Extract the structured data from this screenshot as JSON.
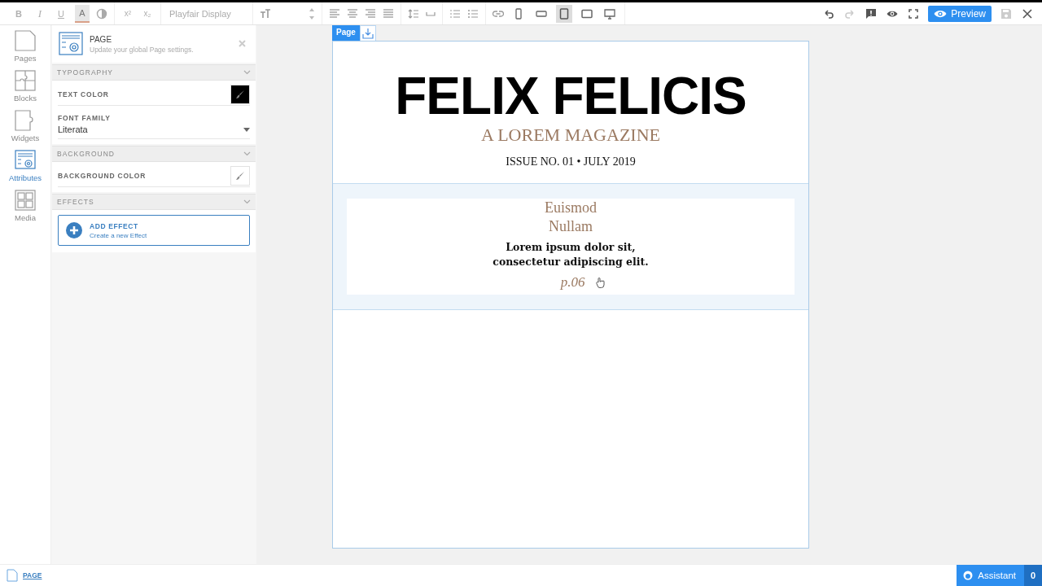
{
  "toolbar": {
    "format": [
      {
        "glyph": "B",
        "kind": "bold",
        "selected": false
      },
      {
        "glyph": "I",
        "kind": "italic",
        "selected": false
      },
      {
        "glyph": "U",
        "kind": "underline",
        "selected": false
      },
      {
        "glyph": "A",
        "kind": "color",
        "selected": true
      }
    ],
    "scripts": [
      {
        "glyph": "x²"
      },
      {
        "glyph": "x₂"
      }
    ],
    "font_field": {
      "placeholder": "Playfair Display"
    },
    "align": [
      {
        "kind": "left"
      },
      {
        "kind": "center"
      },
      {
        "kind": "right"
      },
      {
        "kind": "justify"
      }
    ],
    "devices": [
      {
        "kind": "phone",
        "selected": false
      },
      {
        "kind": "phone-landscape",
        "selected": false
      },
      {
        "kind": "tablet",
        "selected": true
      },
      {
        "kind": "tablet-landscape",
        "selected": false
      },
      {
        "kind": "desktop",
        "selected": false
      }
    ],
    "actions": [
      {
        "kind": "undo",
        "disabled": false
      },
      {
        "kind": "redo",
        "disabled": true
      },
      {
        "kind": "comment",
        "disabled": false
      },
      {
        "kind": "eye",
        "disabled": false
      },
      {
        "kind": "fullscreen",
        "disabled": false
      }
    ],
    "preview_button": "Preview",
    "end_actions": [
      {
        "kind": "save",
        "disabled": true
      },
      {
        "kind": "close",
        "disabled": false
      }
    ]
  },
  "sidebar": {
    "items": [
      {
        "label": "Pages",
        "kind": "pages",
        "selected": false
      },
      {
        "label": "Blocks",
        "kind": "blocks",
        "selected": false
      },
      {
        "label": "Widgets",
        "kind": "widgets",
        "selected": false
      },
      {
        "label": "Attributes",
        "kind": "attributes",
        "selected": true
      },
      {
        "label": "Media",
        "kind": "media",
        "selected": false
      }
    ]
  },
  "panel": {
    "title": "PAGE",
    "subtitle": "Update your global Page settings.",
    "sections": [
      {
        "title": "TYPOGRAPHY",
        "expanded": true,
        "fields": [
          {
            "kind": "color",
            "label": "TEXT COLOR",
            "color": "#000000"
          },
          {
            "kind": "select",
            "label": "FONT FAMILY",
            "value": "Literata"
          }
        ]
      },
      {
        "title": "BACKGROUND",
        "expanded": true,
        "fields": [
          {
            "kind": "color",
            "label": "BACKGROUND COLOR",
            "color": "#ffffff"
          }
        ]
      },
      {
        "title": "EFFECTS",
        "expanded": true,
        "fields": [
          {
            "kind": "add",
            "label": "ADD EFFECT",
            "hint": "Create a new Effect"
          }
        ]
      }
    ]
  },
  "canvas": {
    "tag": "Page",
    "title": "FELIX FELICIS",
    "subtitle": "A LOREM MAGAZINE",
    "issue": "ISSUE NO. 01 • JULY 2019",
    "block": {
      "heading": "Euismod\nNullam",
      "body": "Lorem ipsum dolor sit,\nconsectetur adipiscing elit.",
      "page": "p.06"
    }
  },
  "status_bar": {
    "page_link": "PAGE",
    "assistant": "Assistant",
    "count": "0"
  }
}
